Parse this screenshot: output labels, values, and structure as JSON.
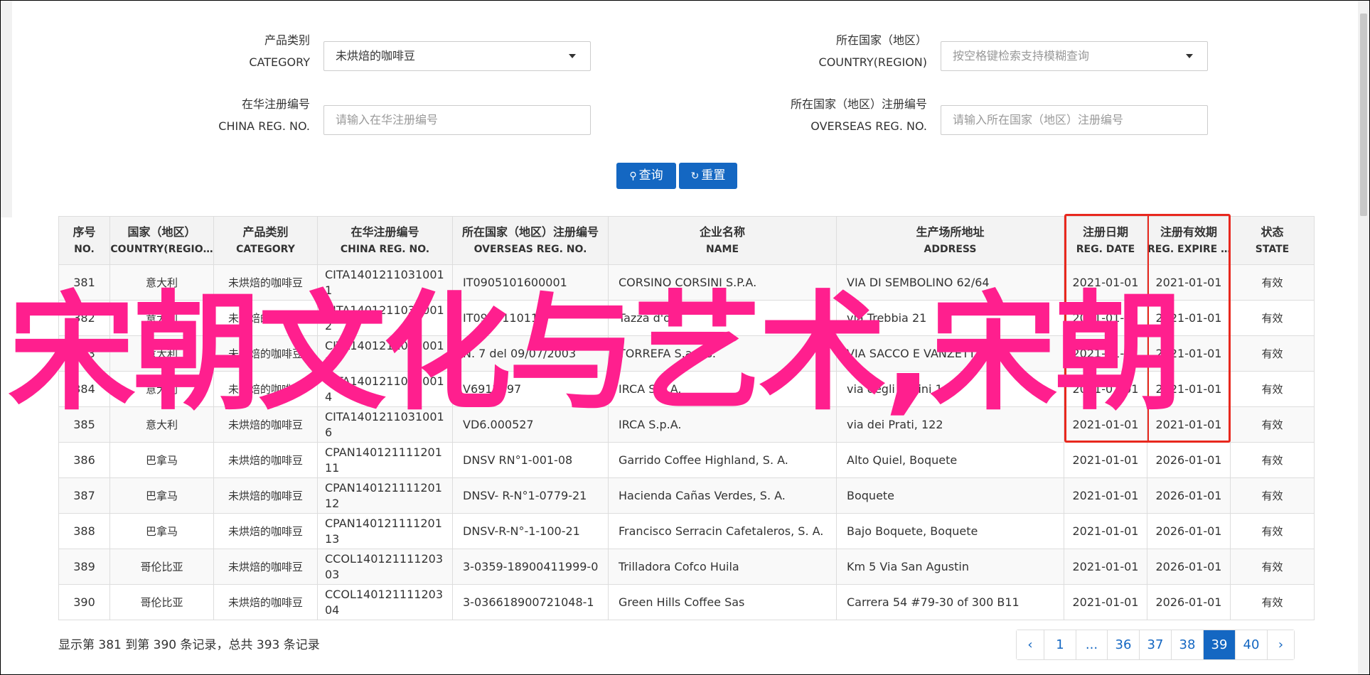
{
  "filters": {
    "category": {
      "label_cn": "产品类别",
      "label_en": "CATEGORY",
      "value": "未烘焙的咖啡豆"
    },
    "country": {
      "label_cn": "所在国家（地区）",
      "label_en": "COUNTRY(REGION)",
      "placeholder": "按空格键检索支持模糊查询"
    },
    "china_reg": {
      "label_cn": "在华注册编号",
      "label_en": "CHINA REG. NO.",
      "placeholder": "请输入在华注册编号"
    },
    "overseas_reg": {
      "label_cn": "所在国家（地区）注册编号",
      "label_en": "OVERSEAS REG. NO.",
      "placeholder": "请输入所在国家（地区）注册编号"
    },
    "search_label": "查询",
    "reset_label": "重置"
  },
  "table": {
    "headers": [
      {
        "cn": "序号",
        "en": "NO."
      },
      {
        "cn": "国家（地区）",
        "en": "COUNTRY(REGIO…"
      },
      {
        "cn": "产品类别",
        "en": "CATEGORY"
      },
      {
        "cn": "在华注册编号",
        "en": "CHINA REG. NO."
      },
      {
        "cn": "所在国家（地区）注册编号",
        "en": "OVERSEAS REG. NO."
      },
      {
        "cn": "企业名称",
        "en": "NAME"
      },
      {
        "cn": "生产场所地址",
        "en": "ADDRESS"
      },
      {
        "cn": "注册日期",
        "en": "REG. DATE"
      },
      {
        "cn": "注册有效期",
        "en": "REG. EXPIRE …"
      },
      {
        "cn": "状态",
        "en": "STATE"
      }
    ],
    "rows": [
      {
        "no": "381",
        "country": "意大利",
        "category": "未烘焙的咖啡豆",
        "china_reg": "CITA14012110310011",
        "overseas_reg": "IT0905101600001",
        "name": "CORSINO CORSINI S.P.A.",
        "address": "VIA DI SEMBOLINO 62/64",
        "reg_date": "2021-01-01",
        "expire": "2021-01-01",
        "state": "有效"
      },
      {
        "no": "382",
        "country": "意大利",
        "category": "未烘焙的咖啡豆",
        "china_reg": "CITA14012110310012",
        "overseas_reg": "IT0920110118",
        "name": "Tazza d'oro",
        "address": "via Trebbia 21",
        "reg_date": "2021-01-01",
        "expire": "2021-01-01",
        "state": "有效"
      },
      {
        "no": "383",
        "country": "意大利",
        "category": "未烘焙的咖啡豆",
        "china_reg": "CITA14012110310013",
        "overseas_reg": "N. 7 del 09/07/2003",
        "name": "TORREFA S.a.a.s.",
        "address": "VIA SACCO E VANZETTI 11",
        "reg_date": "2021-01-01",
        "expire": "2021-01-01",
        "state": "有效"
      },
      {
        "no": "384",
        "country": "意大利",
        "category": "未烘焙的咖啡豆",
        "china_reg": "CITA14012110310014",
        "overseas_reg": "V6912697",
        "name": "IRCA S.p.A.",
        "address": "via degli Orsini 1",
        "reg_date": "2021-01-01",
        "expire": "2021-01-01",
        "state": "有效"
      },
      {
        "no": "385",
        "country": "意大利",
        "category": "未烘焙的咖啡豆",
        "china_reg": "CITA14012110310016",
        "overseas_reg": "VD6.000527",
        "name": "IRCA S.p.A.",
        "address": "via dei Prati, 122",
        "reg_date": "2021-01-01",
        "expire": "2021-01-01",
        "state": "有效"
      },
      {
        "no": "386",
        "country": "巴拿马",
        "category": "未烘焙的咖啡豆",
        "china_reg": "CPAN14012111120111",
        "overseas_reg": "DNSV RN°1-001-08",
        "name": "Garrido Coffee Highland, S. A.",
        "address": "Alto Quiel, Boquete",
        "reg_date": "2021-01-01",
        "expire": "2026-01-01",
        "state": "有效"
      },
      {
        "no": "387",
        "country": "巴拿马",
        "category": "未烘焙的咖啡豆",
        "china_reg": "CPAN14012111120112",
        "overseas_reg": "DNSV- R-N°1-0779-21",
        "name": "Hacienda Cañas Verdes, S. A.",
        "address": "Boquete",
        "reg_date": "2021-01-01",
        "expire": "2026-01-01",
        "state": "有效"
      },
      {
        "no": "388",
        "country": "巴拿马",
        "category": "未烘焙的咖啡豆",
        "china_reg": "CPAN14012111120113",
        "overseas_reg": "DNSV-R-N°-1-100-21",
        "name": "Francisco Serracin Cafetaleros, S. A.",
        "address": "Bajo Boquete, Boquete",
        "reg_date": "2021-01-01",
        "expire": "2026-01-01",
        "state": "有效"
      },
      {
        "no": "389",
        "country": "哥伦比亚",
        "category": "未烘焙的咖啡豆",
        "china_reg": "CCOL14012111120303",
        "overseas_reg": "3-0359-18900411999-0",
        "name": "Trilladora Cofco Huila",
        "address": "Km 5 Via San Agustin",
        "reg_date": "2021-01-01",
        "expire": "2026-01-01",
        "state": "有效"
      },
      {
        "no": "390",
        "country": "哥伦比亚",
        "category": "未烘焙的咖啡豆",
        "china_reg": "CCOL14012111120304",
        "overseas_reg": "3-036618900721048-1",
        "name": "Green Hills Coffee Sas",
        "address": "Carrera 54 #79-30 of 300 B11",
        "reg_date": "2021-01-01",
        "expire": "2026-01-01",
        "state": "有效"
      }
    ]
  },
  "footer": {
    "summary": "显示第 381 到第 390 条记录，总共 393 条记录",
    "pages": [
      "‹",
      "1",
      "...",
      "36",
      "37",
      "38",
      "39",
      "40",
      "›"
    ],
    "active_page": "39"
  },
  "overlay_text": "宋朝文化与艺术,宋朝",
  "colors": {
    "primary": "#1467c2",
    "highlight_box": "#e8281e",
    "overlay": "#ff1f8e"
  }
}
